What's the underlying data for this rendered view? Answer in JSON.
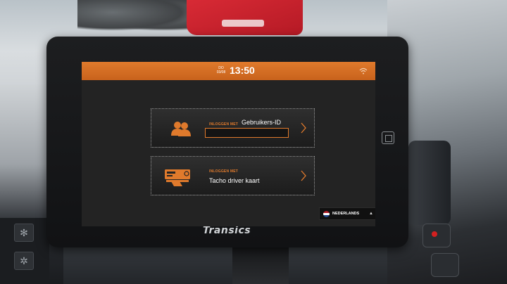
{
  "device": {
    "brand": "Transics"
  },
  "status_bar": {
    "day": "DO",
    "date": "03/08",
    "time": "13:50",
    "wifi_icon": "wifi-icon"
  },
  "login_user_id": {
    "kicker": "INLOGGEN MET",
    "title": "Gebruikers-ID",
    "input_value": "",
    "icon": "users-icon"
  },
  "login_tacho": {
    "kicker": "INLOGGEN MET",
    "title": "Tacho driver kaart",
    "icon": "tacho-card-icon"
  },
  "language": {
    "selected": "NEDERLANDS",
    "flag": "netherlands-flag-icon",
    "caret": "▲"
  },
  "colors": {
    "accent": "#e07a2c",
    "screen_bg": "#232323",
    "text": "#ffffff"
  }
}
